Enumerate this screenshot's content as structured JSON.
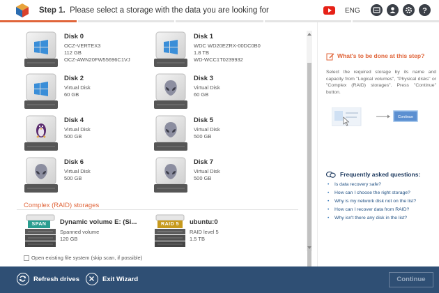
{
  "header": {
    "step_label": "Step 1.",
    "step_text": "Please select a storage with the data you are looking for",
    "language": "ENG",
    "icons": [
      "app-logo-icon",
      "youtube-icon",
      "hdd-icon",
      "user-icon",
      "gear-icon",
      "help-icon"
    ],
    "progress_fraction": 0.175
  },
  "disks": [
    {
      "name": "Disk 0",
      "lines": [
        "OCZ-VERTEX3",
        "112 GB",
        "OCZ-AWN20FW55696C1VJ"
      ],
      "os": "windows"
    },
    {
      "name": "Disk 1",
      "lines": [
        "WDC WD20EZRX-00DC0B0",
        "1.8 TB",
        "WD-WCC1T0239932"
      ],
      "os": "windows"
    },
    {
      "name": "Disk 2",
      "lines": [
        "Virtual Disk",
        "60 GB"
      ],
      "os": "windows"
    },
    {
      "name": "Disk 3",
      "lines": [
        "Virtual Disk",
        "60 GB"
      ],
      "os": "unknown"
    },
    {
      "name": "Disk 4",
      "lines": [
        "Virtual Disk",
        "500 GB"
      ],
      "os": "linux"
    },
    {
      "name": "Disk 5",
      "lines": [
        "Virtual Disk",
        "500 GB"
      ],
      "os": "unknown"
    },
    {
      "name": "Disk 6",
      "lines": [
        "Virtual Disk",
        "500 GB"
      ],
      "os": "unknown"
    },
    {
      "name": "Disk 7",
      "lines": [
        "Virtual Disk",
        "500 GB"
      ],
      "os": "unknown"
    }
  ],
  "raid_section": {
    "title": "Complex (RAID) storages",
    "items": [
      {
        "badge": "SPAN",
        "badge_color": "#2a9d8f",
        "name": "Dynamic volume E: (Si...",
        "lines": [
          "Spanned volume",
          "120 GB"
        ]
      },
      {
        "badge": "RAID 5",
        "badge_color": "#c79a1e",
        "name": "ubuntu:0",
        "lines": [
          "RAID level 5",
          "1.5 TB"
        ]
      }
    ]
  },
  "options": {
    "open_fs_label": "Open existing file system (skip scan, if possible)",
    "open_fs_checked": false
  },
  "side_panel": {
    "help_title": "What's to be done at this step?",
    "help_text": "Select the required storage by its name and capacity from \"Logical volumes\", \"Physical disks\" or \"Complex (RAID) storages\". Press \"Continue\" button.",
    "illustration_button": "Continue",
    "faq_title": "Frequently asked questions:",
    "faq": [
      "Is data recovery safe?",
      "How can I choose the right storage?",
      "Why is my network disk not on the list?",
      "How can I recover data from RAID?",
      "Why isn't there any disk in the list?"
    ]
  },
  "footer": {
    "refresh_label": "Refresh drives",
    "exit_label": "Exit Wizard",
    "continue_label": "Continue"
  },
  "colors": {
    "accent": "#e0653a",
    "footer_bg": "#2f4f74",
    "faq_link": "#1f4f82"
  }
}
